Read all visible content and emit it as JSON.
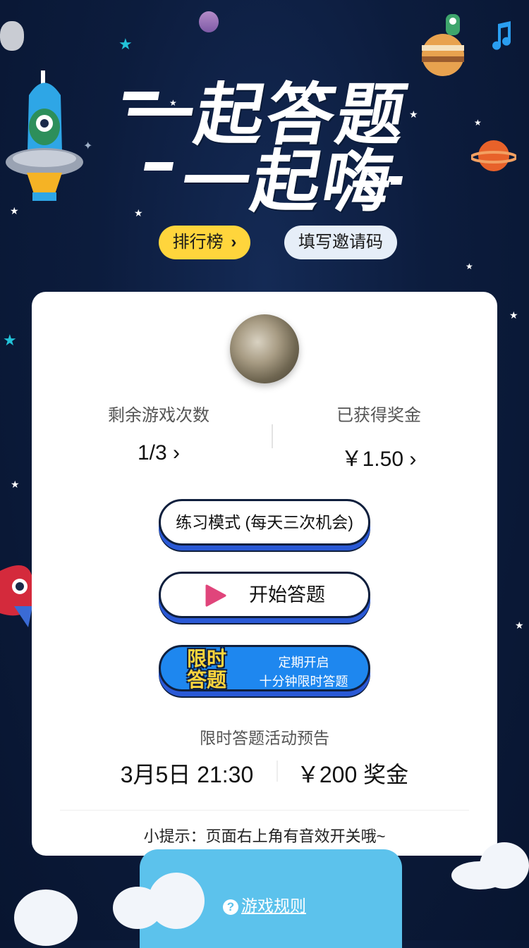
{
  "header": {
    "title_line1": "一起答题",
    "title_line2": "一起嗨",
    "rank_button": "排行榜",
    "invite_button": "填写邀请码"
  },
  "card": {
    "stats": {
      "left_label": "剩余游戏次数",
      "left_value": "1/3",
      "right_label": "已获得奖金",
      "right_value": "￥1.50"
    },
    "practice_button": "练习模式 (每天三次机会)",
    "start_button": "开始答题",
    "timed_button": {
      "badge_line1": "限时",
      "badge_line2": "答题",
      "line1": "定期开启",
      "line2": "十分钟限时答题"
    },
    "preview": {
      "title": "限时答题活动预告",
      "date": "3月5日 21:30",
      "prize": "￥200 奖金"
    },
    "tip": "小提示：页面右上角有音效开关哦~"
  },
  "footer": {
    "rules_link": "游戏规则"
  },
  "icons": {
    "music": "music-note-icon",
    "play": "play-icon",
    "chevron": "chevron-right-icon",
    "help": "question-circle-icon"
  },
  "colors": {
    "background": "#0c1c3d",
    "accent_yellow": "#ffd53c",
    "accent_blue": "#1e87ef",
    "play_pink": "#e0457b",
    "bottom_panel": "#5cc2ec"
  }
}
